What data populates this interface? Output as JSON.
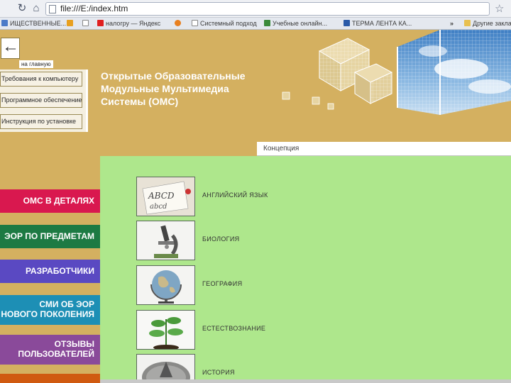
{
  "browser": {
    "url": "file:///E:/index.htm",
    "bookmarks": [
      "ИЩЕСТВЕННЫЕ...",
      "",
      "",
      "налогру — Яндекс",
      "",
      "Системный подход",
      "Учебные онлайн...",
      "ТЕРМА ЛЕНТА КА...",
      "»",
      "Другие закладки"
    ]
  },
  "page": {
    "back_label": "на главную",
    "top_menu": [
      "Требования к компьютеру",
      "Программное обеспечение",
      "Инструкция по установке"
    ],
    "title_lines": [
      "Открытые Образовательные",
      "Модульные Мультимедиа",
      "Системы (ОМС)"
    ],
    "tab_label": "Концепция",
    "subjects": [
      {
        "label": "АНГЛИЙСКИЙ ЯЗЫК",
        "icon": "alphabet-card-icon"
      },
      {
        "label": "БИОЛОГИЯ",
        "icon": "microscope-icon"
      },
      {
        "label": "ГЕОГРАФИЯ",
        "icon": "globe-icon"
      },
      {
        "label": "ЕСТЕСТВОЗНАНИЕ",
        "icon": "sprout-icon"
      },
      {
        "label": "ИСТОРИЯ",
        "icon": "sundial-icon"
      }
    ],
    "side_buttons": [
      {
        "label": "ОМС В ДЕТАЛЯХ",
        "color": "#d9184f"
      },
      {
        "label": "ЭОР ПО ПРЕДМЕТАМ",
        "color": "#1d7a43"
      },
      {
        "label": "РАЗРАБОТЧИКИ",
        "color": "#5a49c2"
      },
      {
        "label_line1": "СМИ ОБ ЭОР",
        "label_line2": "НОВОГО ПОКОЛЕНИЯ",
        "color": "#1d8fb5"
      },
      {
        "label_line1": "ОТЗЫВЫ",
        "label_line2": "ПОЛЬЗОВАТЕЛЕЙ",
        "color": "#8a4a9a"
      },
      {
        "label": "",
        "color": "#d05a10"
      }
    ]
  },
  "colors": {
    "page_bg": "#d4b060",
    "content_bg": "#aee78c"
  }
}
